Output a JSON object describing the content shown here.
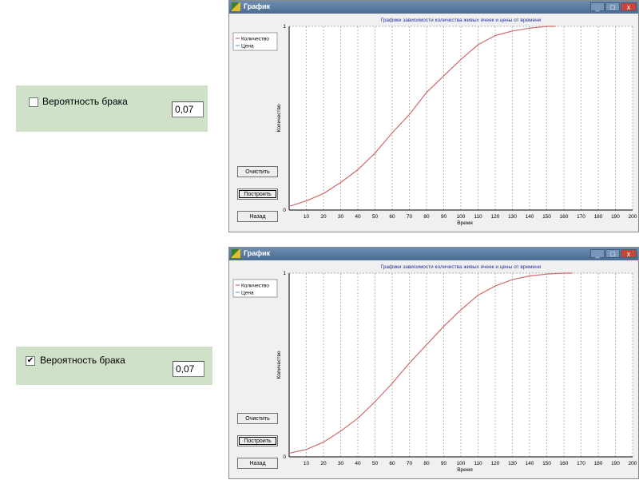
{
  "panels": [
    {
      "checkbox_label": "Вероятность брака",
      "checked": false,
      "check_mark": "",
      "value": "0,07"
    },
    {
      "checkbox_label": "Вероятность брака",
      "checked": true,
      "check_mark": "✔",
      "value": "0,07"
    }
  ],
  "windows": [
    {
      "title": "График",
      "title_bar_buttons": [
        "_",
        "□",
        "x"
      ],
      "buttons": {
        "clear": "Очистить",
        "build": "Построить",
        "back": "Назад"
      }
    },
    {
      "title": "График",
      "title_bar_buttons": [
        "_",
        "□",
        "x"
      ],
      "buttons": {
        "clear": "Очистить",
        "build": "Построить",
        "back": "Назад"
      }
    }
  ],
  "colors": {
    "panel_bg": "#cfe2c9",
    "quantity_line": "#d06a6a",
    "price_line": "#6fa3c8",
    "chart_title": "#2a2aa8"
  },
  "chart_data": [
    {
      "type": "line",
      "title": "Графики зависимости количества живых ячеек и цены от времени",
      "xlabel": "Время",
      "ylabel": "Количество",
      "xlim": [
        0,
        200
      ],
      "ylim": [
        0,
        1
      ],
      "x_ticks": [
        10,
        20,
        30,
        40,
        50,
        60,
        70,
        80,
        90,
        100,
        110,
        120,
        130,
        140,
        150,
        160,
        170,
        180,
        190,
        200
      ],
      "y_ticks": [
        0,
        1
      ],
      "grid": "vertical dashed",
      "legend": "top-left",
      "series": [
        {
          "name": "Количество",
          "color": "#d06a6a",
          "x": [
            0,
            10,
            20,
            30,
            40,
            50,
            60,
            70,
            80,
            90,
            100,
            110,
            120,
            130,
            140,
            150,
            155
          ],
          "y": [
            0.02,
            0.05,
            0.09,
            0.15,
            0.22,
            0.31,
            0.42,
            0.52,
            0.64,
            0.73,
            0.82,
            0.9,
            0.95,
            0.975,
            0.99,
            1.0,
            1.0
          ]
        },
        {
          "name": "Цена",
          "color": "#6fa3c8",
          "x": [],
          "y": []
        }
      ]
    },
    {
      "type": "line",
      "title": "Графики зависимости количества живых ячеек и цены от времени",
      "xlabel": "Время",
      "ylabel": "Количество",
      "xlim": [
        0,
        200
      ],
      "ylim": [
        0,
        1
      ],
      "x_ticks": [
        10,
        20,
        30,
        40,
        50,
        60,
        70,
        80,
        90,
        100,
        110,
        120,
        130,
        140,
        150,
        160,
        170,
        180,
        190,
        200
      ],
      "y_ticks": [
        0,
        1
      ],
      "grid": "vertical dashed",
      "legend": "top-left",
      "series": [
        {
          "name": "Количество",
          "color": "#d06a6a",
          "x": [
            0,
            10,
            20,
            30,
            40,
            50,
            60,
            70,
            80,
            90,
            100,
            110,
            120,
            130,
            140,
            150,
            160,
            165
          ],
          "y": [
            0.02,
            0.04,
            0.08,
            0.14,
            0.21,
            0.3,
            0.4,
            0.51,
            0.61,
            0.71,
            0.8,
            0.88,
            0.93,
            0.965,
            0.985,
            0.995,
            1.0,
            1.0
          ]
        },
        {
          "name": "Цена",
          "color": "#6fa3c8",
          "x": [],
          "y": []
        }
      ]
    }
  ]
}
